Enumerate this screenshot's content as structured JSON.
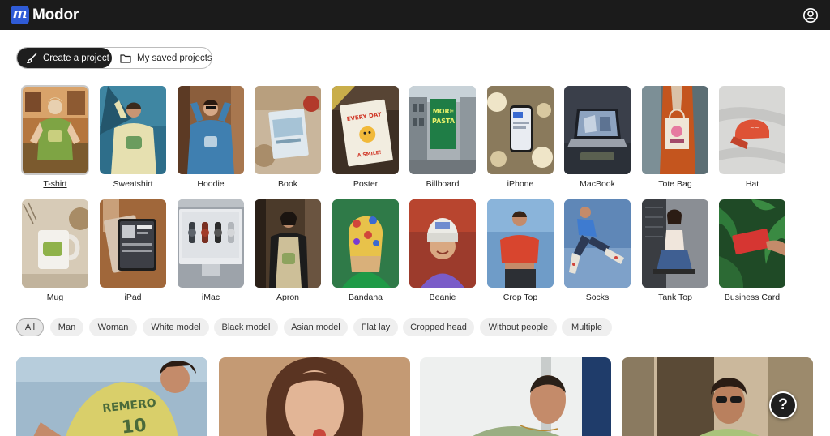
{
  "app": {
    "logo_glyph": "m",
    "name": "Modor"
  },
  "header": {
    "account_icon": "user-circle-icon"
  },
  "project_tabs": {
    "create_label": "Create a project",
    "create_icon": "brush-icon",
    "saved_label": "My saved projects",
    "saved_icon": "folder-icon",
    "active": "create"
  },
  "categories": [
    {
      "label": "T-shirt",
      "selected": true
    },
    {
      "label": "Sweatshirt"
    },
    {
      "label": "Hoodie"
    },
    {
      "label": "Book"
    },
    {
      "label": "Poster",
      "art_text": "EVERY DAY IS BRIGHTER WITH A SMILE"
    },
    {
      "label": "Billboard",
      "art_text": "MORE PASTA"
    },
    {
      "label": "iPhone"
    },
    {
      "label": "MacBook"
    },
    {
      "label": "Tote Bag"
    },
    {
      "label": "Hat"
    },
    {
      "label": "Mug"
    },
    {
      "label": "iPad"
    },
    {
      "label": "iMac"
    },
    {
      "label": "Apron"
    },
    {
      "label": "Bandana"
    },
    {
      "label": "Beanie"
    },
    {
      "label": "Crop Top"
    },
    {
      "label": "Socks"
    },
    {
      "label": "Tank Top"
    },
    {
      "label": "Business Card"
    }
  ],
  "filters": [
    "All",
    "Man",
    "Woman",
    "White model",
    "Black model",
    "Asian model",
    "Flat lay",
    "Cropped head",
    "Without people",
    "Multiple"
  ],
  "active_filter": "All",
  "gallery": [
    {
      "alt": "man in yellow t-shirt"
    },
    {
      "alt": "woman portrait"
    },
    {
      "alt": "man with shaved head"
    },
    {
      "alt": "man with sunglasses"
    }
  ],
  "gallery_print_text": "REMERO 10",
  "help": {
    "label": "?"
  },
  "colors": {
    "topbar": "#1b1b1b",
    "logo": "#2f5bd6",
    "active_segment": "#1e1e1e",
    "chip": "#efefef"
  }
}
